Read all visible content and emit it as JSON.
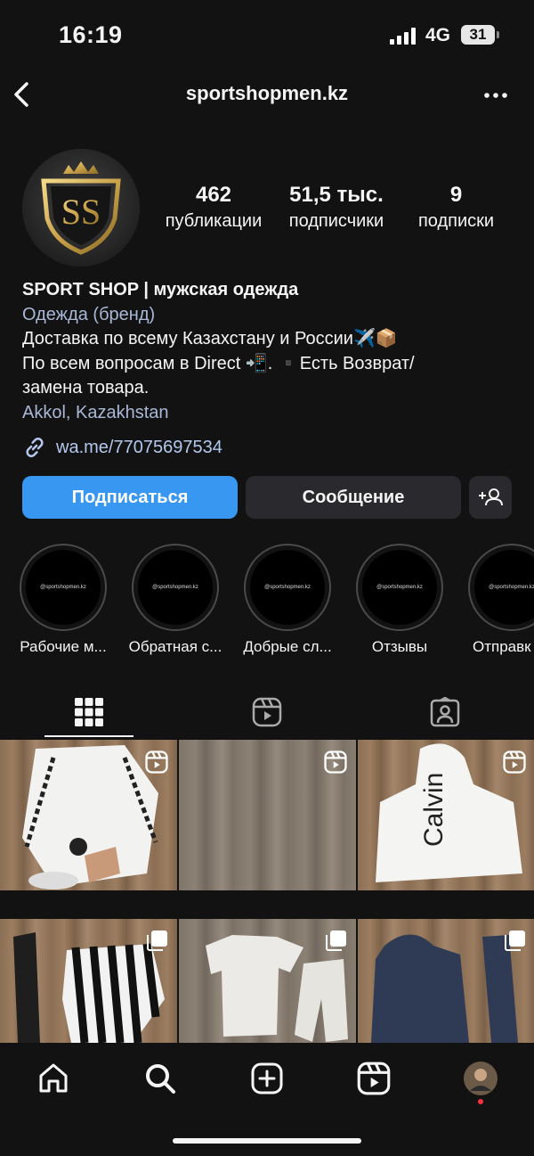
{
  "status_bar": {
    "time": "16:19",
    "network": "4G",
    "battery": "31"
  },
  "header": {
    "username": "sportshopmen.kz"
  },
  "profile": {
    "avatar_text": "SS",
    "stats": [
      {
        "value": "462",
        "label": "публикации"
      },
      {
        "value": "51,5 тыс.",
        "label": "подписчики"
      },
      {
        "value": "9",
        "label": "подписки"
      }
    ],
    "name": "SPORT SHOP | мужская одежда",
    "category": "Одежда (бренд)",
    "bio_line1": "Доставка по всему Казахстану и России✈️📦",
    "bio_line2": "По всем вопросам в Direct 📲. ▪️Есть Возврат/",
    "bio_line3": "замена товара.",
    "location": "Akkol, Kazakhstan",
    "link": "wa.me/77075697534"
  },
  "buttons": {
    "follow": "Подписаться",
    "message": "Сообщение"
  },
  "highlights": [
    {
      "label": "Рабочие м...",
      "cover_text": "@sportshopmen.kz"
    },
    {
      "label": "Обратная с...",
      "cover_text": "@sportshopmen.kz"
    },
    {
      "label": "Добрые сл...",
      "cover_text": "@sportshopmen.kz"
    },
    {
      "label": "Отзывы",
      "cover_text": "@sportshopmen.kz"
    },
    {
      "label": "Отправк",
      "cover_text": "@sportshopmen.kz"
    }
  ],
  "tabs": [
    {
      "name": "posts-grid",
      "icon": "grid-icon",
      "active": true
    },
    {
      "name": "reels",
      "icon": "reels-icon",
      "active": false
    },
    {
      "name": "tagged",
      "icon": "tagged-user-icon",
      "active": false
    }
  ],
  "grid_posts": [
    {
      "type": "reel",
      "subject": "white Dior shirt set"
    },
    {
      "type": "reel",
      "subject": "empty wood background"
    },
    {
      "type": "reel",
      "subject": "white Calvin Klein hoodie",
      "print_text": "Calvin"
    },
    {
      "type": "carousel",
      "subject": "black and white striped shirt with black pants"
    },
    {
      "type": "carousel",
      "subject": "white t-shirt and shorts set"
    },
    {
      "type": "carousel",
      "subject": "navy Armani Exchange tracksuit"
    }
  ],
  "bottom_nav": [
    {
      "name": "home",
      "icon": "home-icon"
    },
    {
      "name": "search",
      "icon": "search-icon"
    },
    {
      "name": "create",
      "icon": "plus-square-icon"
    },
    {
      "name": "reels",
      "icon": "reels-icon"
    },
    {
      "name": "profile",
      "icon": "avatar"
    }
  ],
  "colors": {
    "background": "#121212",
    "primary_button": "#3897f0",
    "secondary_button": "#2a2a2e",
    "link": "#b4c8ef",
    "category": "#a9b8d6",
    "notification_dot": "#ff3040"
  }
}
